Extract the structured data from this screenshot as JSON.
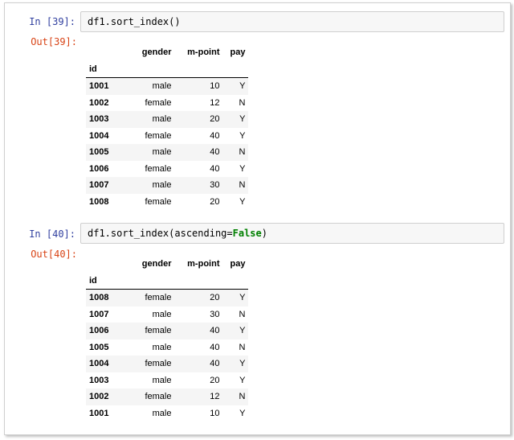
{
  "cells": [
    {
      "in_prompt": "In  [39]:",
      "code": "df1.sort_index()",
      "out_prompt": "Out[39]:",
      "columns": [
        "gender",
        "m-point",
        "pay"
      ],
      "index_name": "id",
      "rows": [
        {
          "id": "1001",
          "gender": "male",
          "mpoint": "10",
          "pay": "Y"
        },
        {
          "id": "1002",
          "gender": "female",
          "mpoint": "12",
          "pay": "N"
        },
        {
          "id": "1003",
          "gender": "male",
          "mpoint": "20",
          "pay": "Y"
        },
        {
          "id": "1004",
          "gender": "female",
          "mpoint": "40",
          "pay": "Y"
        },
        {
          "id": "1005",
          "gender": "male",
          "mpoint": "40",
          "pay": "N"
        },
        {
          "id": "1006",
          "gender": "female",
          "mpoint": "40",
          "pay": "Y"
        },
        {
          "id": "1007",
          "gender": "male",
          "mpoint": "30",
          "pay": "N"
        },
        {
          "id": "1008",
          "gender": "female",
          "mpoint": "20",
          "pay": "Y"
        }
      ]
    },
    {
      "in_prompt": "In  [40]:",
      "code_prefix": "df1.sort_index(ascending=",
      "code_keyword": "False",
      "code_suffix": ")",
      "out_prompt": "Out[40]:",
      "columns": [
        "gender",
        "m-point",
        "pay"
      ],
      "index_name": "id",
      "rows": [
        {
          "id": "1008",
          "gender": "female",
          "mpoint": "20",
          "pay": "Y"
        },
        {
          "id": "1007",
          "gender": "male",
          "mpoint": "30",
          "pay": "N"
        },
        {
          "id": "1006",
          "gender": "female",
          "mpoint": "40",
          "pay": "Y"
        },
        {
          "id": "1005",
          "gender": "male",
          "mpoint": "40",
          "pay": "N"
        },
        {
          "id": "1004",
          "gender": "female",
          "mpoint": "40",
          "pay": "Y"
        },
        {
          "id": "1003",
          "gender": "male",
          "mpoint": "20",
          "pay": "Y"
        },
        {
          "id": "1002",
          "gender": "female",
          "mpoint": "12",
          "pay": "N"
        },
        {
          "id": "1001",
          "gender": "male",
          "mpoint": "10",
          "pay": "Y"
        }
      ]
    }
  ]
}
